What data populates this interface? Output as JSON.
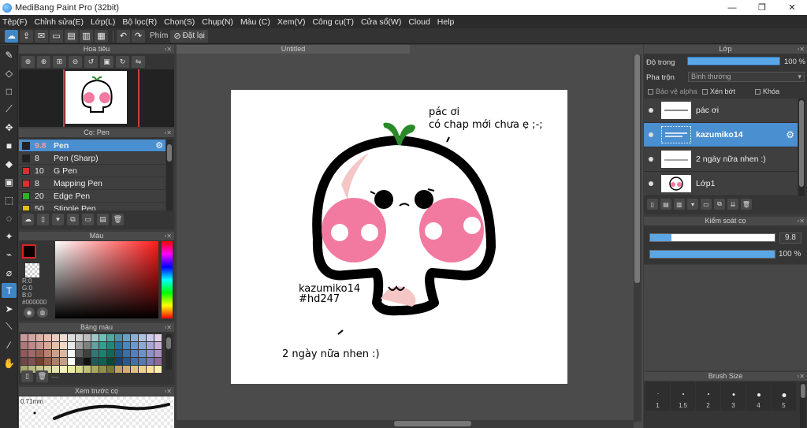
{
  "window": {
    "title": "MediBang Paint Pro (32bit)",
    "controls": [
      "—",
      "❐",
      "✕"
    ]
  },
  "menu": [
    "Tệp(F)",
    "Chỉnh sửa(E)",
    "Lớp(L)",
    "Bộ lọc(R)",
    "Chọn(S)",
    "Chụp(N)",
    "Màu (C)",
    "Xem(V)",
    "Công cụ(T)",
    "Cửa sổ(W)",
    "Cloud",
    "Help"
  ],
  "toolbar": {
    "shortcut_label": "Phím",
    "reset_label": "Đặt lại"
  },
  "navigator": {
    "title": "Hoa tiêu"
  },
  "brush_panel": {
    "title": "Cọ: Pen",
    "items": [
      {
        "size": "9.8",
        "name": "Pen",
        "color": "#222222",
        "selected": true
      },
      {
        "size": "8",
        "name": "Pen (Sharp)",
        "color": "#222222"
      },
      {
        "size": "10",
        "name": "G Pen",
        "color": "#d93030"
      },
      {
        "size": "8",
        "name": "Mapping Pen",
        "color": "#d93030"
      },
      {
        "size": "20",
        "name": "Edge Pen",
        "color": "#2db02d"
      },
      {
        "size": "50",
        "name": "Stipple Pen",
        "color": "#e0c020"
      }
    ]
  },
  "color_panel": {
    "title": "Màu",
    "r": "R:0",
    "g": "G:0",
    "b": "B:0",
    "hex": "#000000"
  },
  "palette_panel": {
    "title": "Bảng màu",
    "more": "---",
    "swatches": [
      "#c99a9a",
      "#d4a3a3",
      "#dcb0a8",
      "#e8c0b0",
      "#e6d0c0",
      "#f0dcd0",
      "#dcdcdc",
      "#cfcfcf",
      "#bebebe",
      "#a0c8c8",
      "#70c0b8",
      "#50a8a0",
      "#5090a8",
      "#6aa0c8",
      "#88b0d8",
      "#b0c0e0",
      "#c8c8e8",
      "#e0d0e8",
      "#b07878",
      "#c08888",
      "#c89890",
      "#d8a898",
      "#e0c0b0",
      "#f0d8c8",
      "#e8e8e8",
      "#a0a0a0",
      "#808080",
      "#60a0a0",
      "#30a090",
      "#208878",
      "#2870a0",
      "#4888c0",
      "#6898d0",
      "#90a8d8",
      "#a8a8d8",
      "#c8b0d8",
      "#905858",
      "#a06868",
      "#986050",
      "#b88070",
      "#c8a090",
      "#d8b8a0",
      "#f8f8f8",
      "#606060",
      "#404040",
      "#307878",
      "#208070",
      "#106858",
      "#205888",
      "#3870a8",
      "#5080c0",
      "#7090c8",
      "#9090c8",
      "#a890c0",
      "#704848",
      "#805050",
      "#704030",
      "#906050",
      "#a88070",
      "#c0a088",
      "#ffffff",
      "#303030",
      "#101010",
      "#205858",
      "#106050",
      "#084838",
      "#184070",
      "#285890",
      "#4070a8",
      "#5878b0",
      "#7878b0",
      "#906898",
      "#a8a870",
      "#b8b880",
      "#c8c890",
      "#d0d0a0",
      "#e0e0b0",
      "#f0f0c0",
      "#eeeeaa",
      "#d8d890",
      "#c0c078",
      "#a8a860",
      "#909048",
      "#787830",
      "#c0a060",
      "#d0b070",
      "#e0c080",
      "#f0d090",
      "#ffe0a0",
      "#fff0b0"
    ]
  },
  "brush_preview": {
    "title": "Xem trước cọ",
    "size": "0.71mm"
  },
  "document": {
    "tab": "Untitled"
  },
  "artwork": {
    "text_top_1": "pác ơi",
    "text_top_2": "có chap mới chưa ẹ ;-;",
    "text_name": "kazumiko14",
    "text_tag": "#hd247",
    "text_bottom": "2 ngày nữa nhen :)"
  },
  "layers_panel": {
    "title": "Lớp",
    "opacity_label": "Độ trong",
    "opacity_value": "100 %",
    "blend_label": "Pha trộn",
    "blend_value": "Bình thường",
    "protect_alpha": "Bảo vệ alpha",
    "clip": "Xén bớt",
    "lock": "Khóa",
    "layers": [
      {
        "name": "pác ơi",
        "selected": false
      },
      {
        "name": "kazumiko14",
        "selected": true
      },
      {
        "name": "2 ngày nữa nhen :)",
        "selected": false
      },
      {
        "name": "Lớp1",
        "selected": false
      }
    ]
  },
  "brush_control": {
    "title": "Kiểm soát cọ",
    "size_value": "9.8",
    "size_fraction": 0.17,
    "opacity_value": "100 %",
    "opacity_fraction": 1.0
  },
  "brush_size": {
    "title": "Brush Size",
    "sizes": [
      "1",
      "1.5",
      "2",
      "3",
      "4",
      "5"
    ]
  }
}
